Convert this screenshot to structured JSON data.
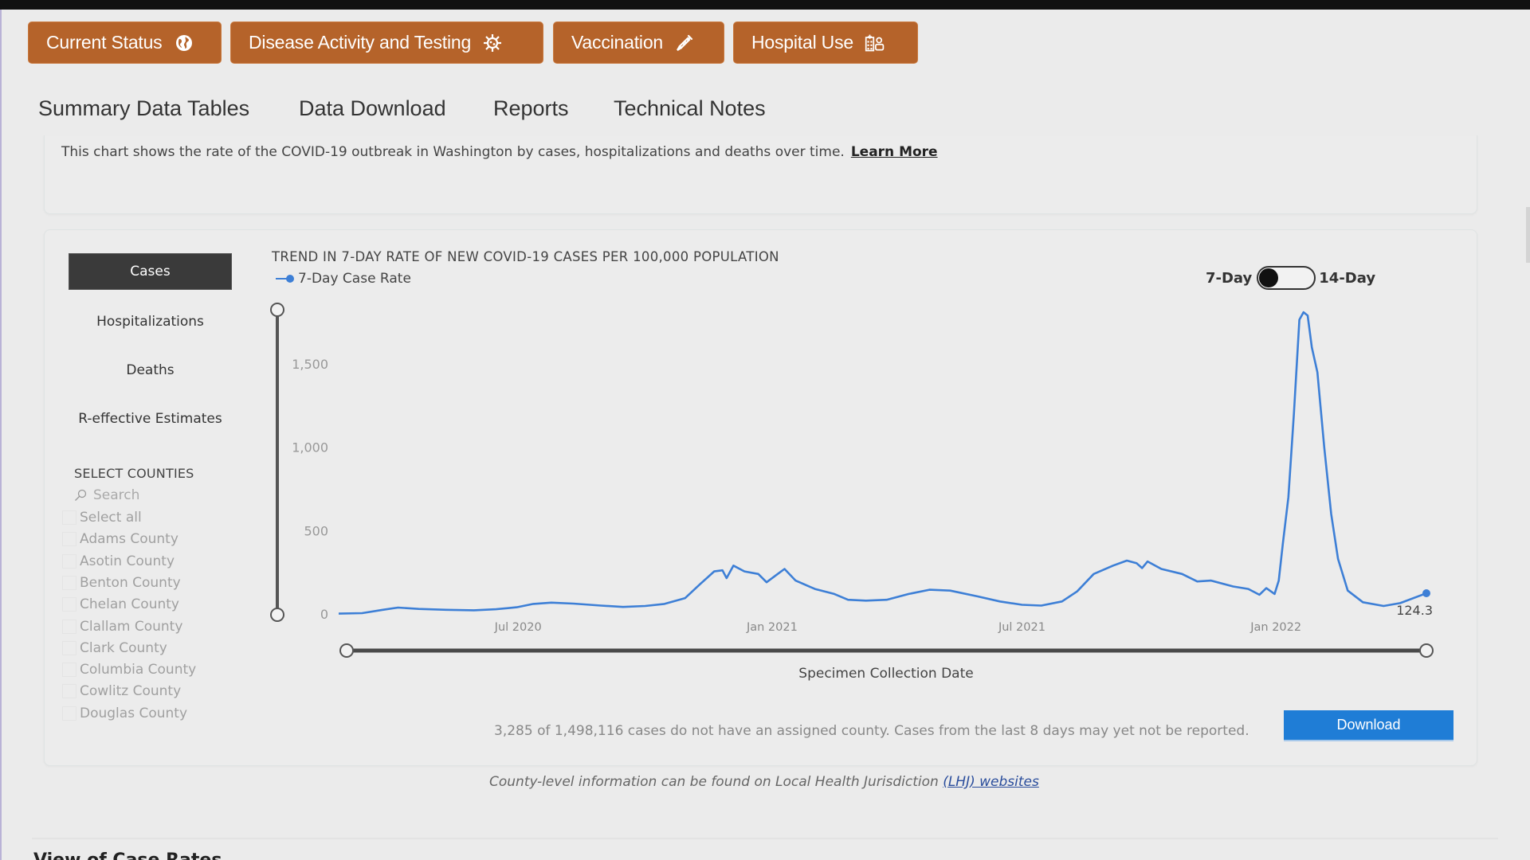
{
  "top_nav": [
    {
      "label": "Current Status",
      "icon": "globe-icon"
    },
    {
      "label": "Disease Activity and Testing",
      "icon": "virus-icon"
    },
    {
      "label": "Vaccination",
      "icon": "syringe-icon"
    },
    {
      "label": "Hospital Use",
      "icon": "hospital-icon"
    }
  ],
  "sub_nav": [
    "Summary Data Tables",
    "Data Download",
    "Reports",
    "Technical Notes"
  ],
  "intro": {
    "text": "This chart shows the rate of the COVID-19 outbreak in Washington by cases, hospitalizations and deaths over time.",
    "link": "Learn More"
  },
  "metrics": [
    {
      "label": "Cases",
      "active": true
    },
    {
      "label": "Hospitalizations",
      "active": false
    },
    {
      "label": "Deaths",
      "active": false
    },
    {
      "label": "R-effective Estimates",
      "active": false
    }
  ],
  "counties": {
    "title": "SELECT COUNTIES",
    "search_placeholder": "Search",
    "items": [
      "Select all",
      "Adams County",
      "Asotin County",
      "Benton County",
      "Chelan County",
      "Clallam County",
      "Clark County",
      "Columbia County",
      "Cowlitz County",
      "Douglas County"
    ]
  },
  "toggle": {
    "left": "7-Day",
    "right": "14-Day",
    "selected": "7-Day"
  },
  "colors": {
    "accent_orange": "#b5632a",
    "line_blue": "#3d7fd6",
    "download_blue": "#1f7dd6"
  },
  "chart_data": {
    "type": "line",
    "title": "TREND IN 7-DAY RATE OF NEW COVID-19 CASES PER 100,000 POPULATION",
    "legend": [
      "7-Day Case Rate"
    ],
    "legend_position": "top-left",
    "xlabel": "Specimen Collection Date",
    "ylabel": "",
    "ylim": [
      0,
      1800
    ],
    "yticks": [
      0,
      500,
      1000,
      1500
    ],
    "ytick_labels": [
      "0",
      "500",
      "1,000",
      "1,500"
    ],
    "xticks": [
      "2020-07-01",
      "2021-01-01",
      "2021-07-01",
      "2022-01-01"
    ],
    "xtick_labels": [
      "Jul 2020",
      "Jan 2021",
      "Jul 2021",
      "Jan 2022"
    ],
    "xlim": [
      "2020-02-22",
      "2022-04-20"
    ],
    "grid": false,
    "last_value_label": "124.3",
    "series": [
      {
        "name": "7-Day Case Rate",
        "points": [
          [
            "2020-02-22",
            2
          ],
          [
            "2020-03-10",
            5
          ],
          [
            "2020-03-25",
            25
          ],
          [
            "2020-04-05",
            38
          ],
          [
            "2020-04-20",
            30
          ],
          [
            "2020-05-10",
            25
          ],
          [
            "2020-05-30",
            22
          ],
          [
            "2020-06-15",
            28
          ],
          [
            "2020-06-30",
            40
          ],
          [
            "2020-07-12",
            60
          ],
          [
            "2020-07-25",
            68
          ],
          [
            "2020-08-10",
            62
          ],
          [
            "2020-08-30",
            50
          ],
          [
            "2020-09-15",
            42
          ],
          [
            "2020-10-01",
            48
          ],
          [
            "2020-10-15",
            60
          ],
          [
            "2020-10-30",
            95
          ],
          [
            "2020-11-10",
            180
          ],
          [
            "2020-11-20",
            255
          ],
          [
            "2020-11-26",
            262
          ],
          [
            "2020-11-29",
            215
          ],
          [
            "2020-12-04",
            290
          ],
          [
            "2020-12-12",
            255
          ],
          [
            "2020-12-22",
            240
          ],
          [
            "2020-12-28",
            190
          ],
          [
            "2021-01-05",
            240
          ],
          [
            "2021-01-10",
            270
          ],
          [
            "2021-01-18",
            200
          ],
          [
            "2021-02-01",
            150
          ],
          [
            "2021-02-15",
            120
          ],
          [
            "2021-02-25",
            85
          ],
          [
            "2021-03-10",
            80
          ],
          [
            "2021-03-25",
            85
          ],
          [
            "2021-04-10",
            120
          ],
          [
            "2021-04-25",
            145
          ],
          [
            "2021-05-10",
            140
          ],
          [
            "2021-05-30",
            105
          ],
          [
            "2021-06-15",
            75
          ],
          [
            "2021-07-01",
            55
          ],
          [
            "2021-07-15",
            50
          ],
          [
            "2021-07-30",
            75
          ],
          [
            "2021-08-10",
            135
          ],
          [
            "2021-08-22",
            240
          ],
          [
            "2021-09-05",
            290
          ],
          [
            "2021-09-15",
            320
          ],
          [
            "2021-09-22",
            305
          ],
          [
            "2021-09-26",
            275
          ],
          [
            "2021-09-30",
            315
          ],
          [
            "2021-10-10",
            270
          ],
          [
            "2021-10-25",
            240
          ],
          [
            "2021-11-05",
            195
          ],
          [
            "2021-11-15",
            200
          ],
          [
            "2021-12-01",
            165
          ],
          [
            "2021-12-12",
            150
          ],
          [
            "2021-12-20",
            115
          ],
          [
            "2021-12-25",
            155
          ],
          [
            "2021-12-31",
            120
          ],
          [
            "2022-01-03",
            200
          ],
          [
            "2022-01-06",
            420
          ],
          [
            "2022-01-10",
            700
          ],
          [
            "2022-01-14",
            1200
          ],
          [
            "2022-01-18",
            1765
          ],
          [
            "2022-01-21",
            1810
          ],
          [
            "2022-01-24",
            1790
          ],
          [
            "2022-01-27",
            1600
          ],
          [
            "2022-01-31",
            1450
          ],
          [
            "2022-02-05",
            1000
          ],
          [
            "2022-02-10",
            600
          ],
          [
            "2022-02-15",
            330
          ],
          [
            "2022-02-22",
            140
          ],
          [
            "2022-03-05",
            70
          ],
          [
            "2022-03-20",
            48
          ],
          [
            "2022-04-01",
            65
          ],
          [
            "2022-04-20",
            124.3
          ]
        ]
      }
    ]
  },
  "footnote": "3,285 of 1,498,116 cases do not have an assigned county. Cases from the last 8 days may yet not be reported.",
  "download_label": "Download",
  "lhj": {
    "text": "County-level information can be found on Local Health Jurisdiction ",
    "link": "(LHJ) websites"
  },
  "next_section_heading": "View of Case Rates"
}
